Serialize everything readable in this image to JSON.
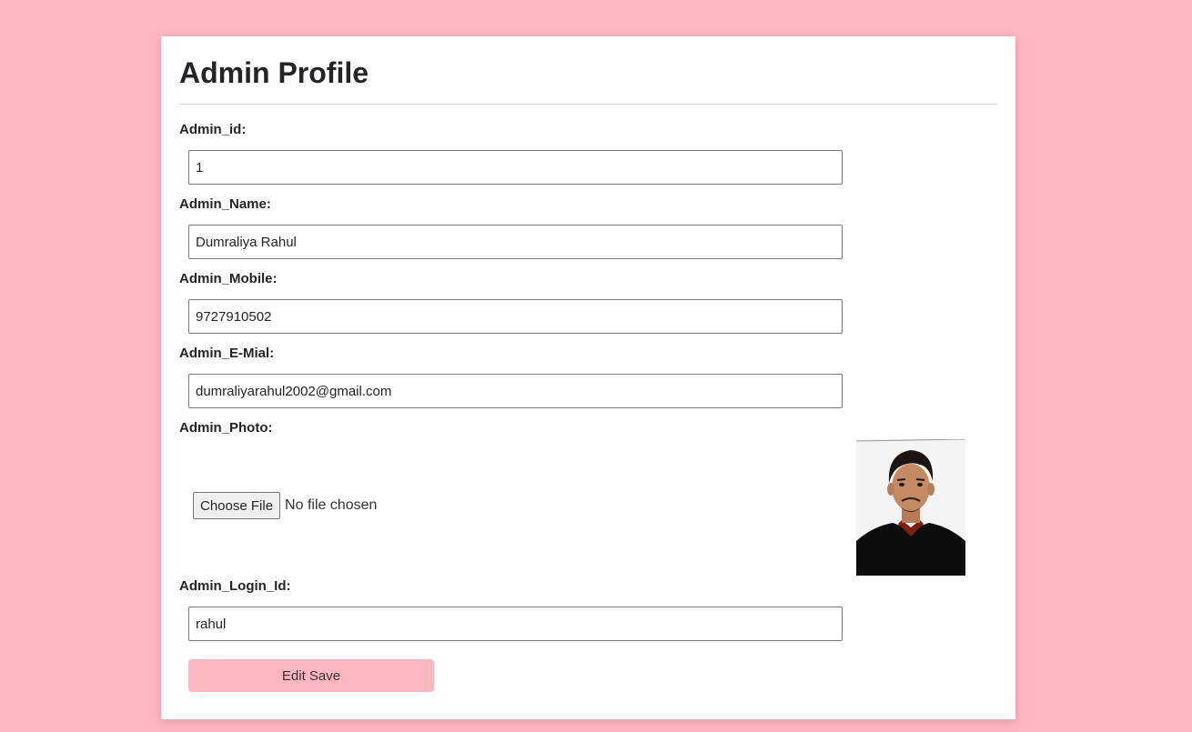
{
  "page": {
    "title": "Admin Profile",
    "background_color": "#ffb6c1"
  },
  "form": {
    "admin_id": {
      "label": "Admin_id:",
      "value": "1"
    },
    "admin_name": {
      "label": "Admin_Name:",
      "value": "Dumraliya Rahul"
    },
    "admin_mobile": {
      "label": "Admin_Mobile:",
      "value": "9727910502"
    },
    "admin_email": {
      "label": "Admin_E-Mial:",
      "value": "dumraliyarahul2002@gmail.com"
    },
    "admin_photo": {
      "label": "Admin_Photo:",
      "button_label": "Choose File",
      "status_text": "No file chosen"
    },
    "admin_login_id": {
      "label": "Admin_Login_Id:",
      "value": "rahul"
    },
    "submit": {
      "label": "Edit Save",
      "color": "#ffb6c1"
    }
  }
}
